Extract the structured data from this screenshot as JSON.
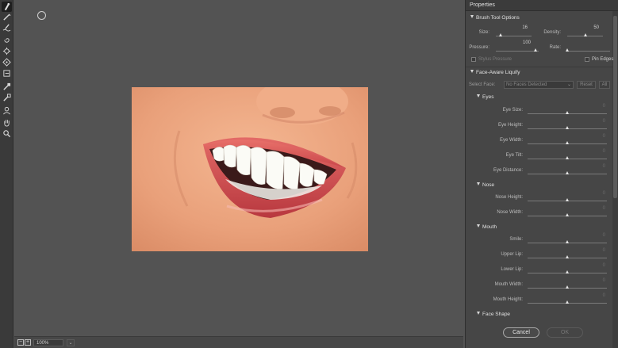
{
  "panel": {
    "title": "Properties"
  },
  "brush_tool_options": {
    "heading": "Brush Tool Options",
    "size": {
      "label": "Size:",
      "value": "16",
      "level": 0.05
    },
    "density": {
      "label": "Density:",
      "value": "50",
      "level": 0.5
    },
    "pressure": {
      "label": "Pressure:",
      "value": "100",
      "level": 1.0
    },
    "rate": {
      "label": "Rate:",
      "value": "",
      "level": 0.0
    },
    "stylus_pressure": "Stylus Pressure",
    "pin_edges": "Pin Edges"
  },
  "face_aware_liquify": {
    "heading": "Face-Aware Liquify",
    "select_face_label": "Select Face:",
    "select_face_value": "No Faces Detected",
    "reset_label": "Reset",
    "all_label": "All",
    "eyes": {
      "heading": "Eyes",
      "sliders": [
        {
          "label": "Eye Size:",
          "value": "0"
        },
        {
          "label": "Eye Height:",
          "value": "0"
        },
        {
          "label": "Eye Width:",
          "value": "0"
        },
        {
          "label": "Eye Tilt:",
          "value": "0"
        },
        {
          "label": "Eye Distance:",
          "value": "0"
        }
      ]
    },
    "nose": {
      "heading": "Nose",
      "sliders": [
        {
          "label": "Nose Height:",
          "value": "0"
        },
        {
          "label": "Nose Width:",
          "value": "0"
        }
      ]
    },
    "mouth": {
      "heading": "Mouth",
      "sliders": [
        {
          "label": "Smile:",
          "value": "0"
        },
        {
          "label": "Upper Lip:",
          "value": "0"
        },
        {
          "label": "Lower Lip:",
          "value": "0"
        },
        {
          "label": "Mouth Width:",
          "value": "0"
        },
        {
          "label": "Mouth Height:",
          "value": "0"
        }
      ]
    },
    "face_shape": {
      "heading": "Face Shape"
    }
  },
  "buttons": {
    "cancel": "Cancel",
    "ok": "OK"
  },
  "statusbar": {
    "zoom": "100%"
  },
  "colors": {
    "annotation_arrow": "#cc1f1f",
    "panel_bg": "#464646",
    "canvas_bg": "#535353"
  },
  "toolbar": {
    "tools": [
      {
        "icon": "forward-warp-icon",
        "active": true
      },
      {
        "icon": "reconstruct-icon"
      },
      {
        "icon": "smooth-icon"
      },
      {
        "icon": "twirl-icon"
      },
      {
        "icon": "pucker-icon"
      },
      {
        "icon": "bloat-icon"
      },
      {
        "icon": "push-left-icon"
      },
      {
        "icon": "freeze-mask-icon"
      },
      {
        "icon": "thaw-mask-icon"
      },
      {
        "icon": "face-tool-icon"
      },
      {
        "icon": "hand-icon"
      },
      {
        "icon": "zoom-icon"
      }
    ]
  }
}
